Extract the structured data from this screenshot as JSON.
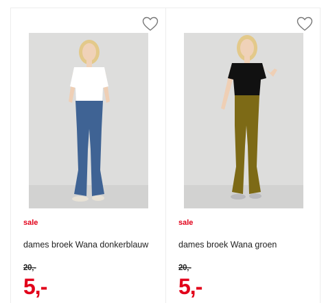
{
  "products": [
    {
      "badge": "sale",
      "title": "dames broek Wana donkerblauw",
      "old_price": "20,-",
      "new_price": "5,-",
      "image": "woman-blue-flared-pants-photo",
      "pants_color": "#3f6394",
      "top_color": "#ffffff",
      "favorite_icon": "heart-outline-icon"
    },
    {
      "badge": "sale",
      "title": "dames broek Wana groen",
      "old_price": "20,-",
      "new_price": "5,-",
      "image": "woman-olive-flared-pants-photo",
      "pants_color": "#7d6a16",
      "top_color": "#111111",
      "favorite_icon": "heart-outline-icon"
    }
  ],
  "colors": {
    "sale": "#e2001a",
    "text": "#222222",
    "border": "#ececec"
  }
}
